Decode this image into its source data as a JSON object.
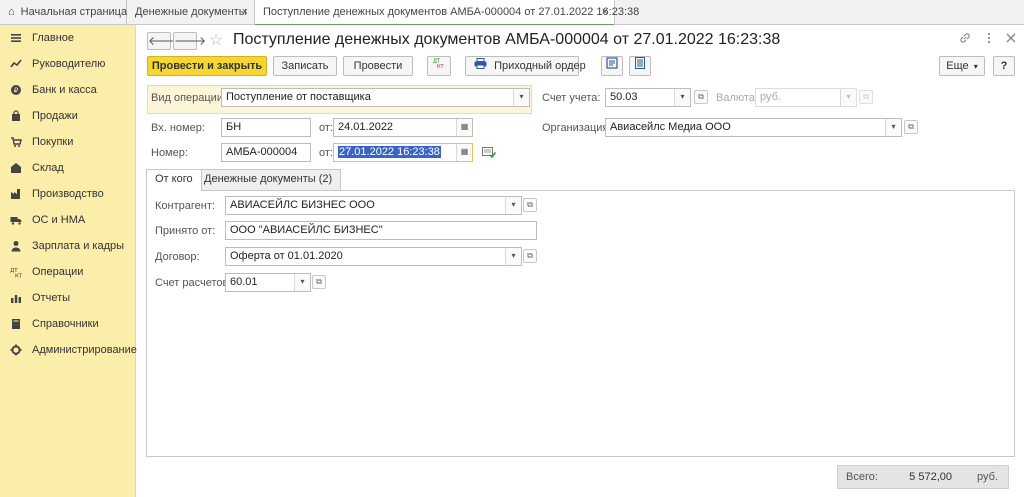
{
  "tabs": [
    {
      "label": "Начальная страница"
    },
    {
      "label": "Денежные документы"
    },
    {
      "label": "Поступление денежных документов АМБА-000004 от 27.01.2022 16:23:38"
    }
  ],
  "tab_close": "×",
  "sidebar": {
    "items": [
      {
        "label": "Главное",
        "icon": "menu-icon"
      },
      {
        "label": "Руководителю",
        "icon": "trend-icon"
      },
      {
        "label": "Банк и касса",
        "icon": "coin-icon"
      },
      {
        "label": "Продажи",
        "icon": "bag-icon"
      },
      {
        "label": "Покупки",
        "icon": "cart-icon"
      },
      {
        "label": "Склад",
        "icon": "warehouse-icon"
      },
      {
        "label": "Производство",
        "icon": "factory-icon"
      },
      {
        "label": "ОС и НМА",
        "icon": "truck-icon"
      },
      {
        "label": "Зарплата и кадры",
        "icon": "person-icon"
      },
      {
        "label": "Операции",
        "icon": "dtkt-icon"
      },
      {
        "label": "Отчеты",
        "icon": "bar-chart-icon"
      },
      {
        "label": "Справочники",
        "icon": "book-icon"
      },
      {
        "label": "Администрирование",
        "icon": "gear-icon"
      }
    ]
  },
  "document": {
    "title": "Поступление денежных документов АМБА-000004 от 27.01.2022 16:23:38"
  },
  "toolbar": {
    "post_close": "Провести и закрыть",
    "save": "Записать",
    "post": "Провести",
    "dtkt": "ДТ КТ",
    "receipt_order": "Приходный ордер",
    "more": "Еще",
    "help": "?"
  },
  "form": {
    "operation_label": "Вид операции:",
    "operation_value": "Поступление от поставщика",
    "account_label": "Счет учета:",
    "account_value": "50.03",
    "currency_label": "Валюта:",
    "currency_value": "руб.",
    "in_number_label": "Вх. номер:",
    "in_number_value": "БН",
    "in_date_label": "от:",
    "in_date_value": "24.01.2022",
    "org_label": "Организация:",
    "org_value": "Авиасейлс Медиа ООО",
    "number_label": "Номер:",
    "number_value": "АМБА-000004",
    "date_label": "от:",
    "date_value": "27.01.2022 16:23:38"
  },
  "inner_tabs": [
    {
      "label": "От кого"
    },
    {
      "label": "Денежные документы (2)"
    }
  ],
  "from_tab": {
    "counterparty_label": "Контрагент:",
    "counterparty_value": "АВИАСЕЙЛС БИЗНЕС ООО",
    "received_from_label": "Принято от:",
    "received_from_value": "ООО \"АВИАСЕЙЛС  БИЗНЕС\"",
    "contract_label": "Договор:",
    "contract_value": "Оферта от 01.01.2020",
    "settlement_label": "Счет расчетов:",
    "settlement_value": "60.01"
  },
  "footer": {
    "total_label": "Всего:",
    "total_value": "5 572,00",
    "currency": "руб."
  },
  "glyphs": {
    "back": "🡐",
    "forward": "🡒",
    "star": "☆",
    "dropdown": "▾",
    "open": "⧉",
    "calendar": "▦",
    "home": "⌂",
    "chevron": "▾"
  }
}
